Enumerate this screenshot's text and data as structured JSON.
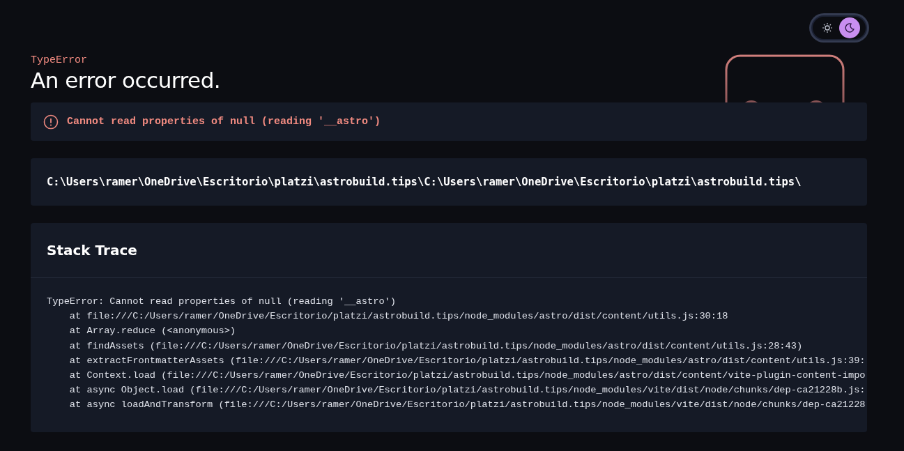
{
  "theme_toggle": {
    "options": [
      {
        "kind": "sun",
        "selected": false
      },
      {
        "kind": "moon",
        "selected": true
      }
    ]
  },
  "error": {
    "name": "TypeError",
    "title": "An error occurred.",
    "message": "Cannot read properties of null (reading '__astro')"
  },
  "file_path": "C:\\Users\\ramer\\OneDrive\\Escritorio\\platzi\\astrobuild.tips\\C:\\Users\\ramer\\OneDrive\\Escritorio\\platzi\\astrobuild.tips\\",
  "stack_trace": {
    "title": "Stack Trace",
    "lines": [
      "TypeError: Cannot read properties of null (reading '__astro')",
      "    at file:///C:/Users/ramer/OneDrive/Escritorio/platzi/astrobuild.tips/node_modules/astro/dist/content/utils.js:30:18",
      "    at Array.reduce (<anonymous>)",
      "    at findAssets (file:///C:/Users/ramer/OneDrive/Escritorio/platzi/astrobuild.tips/node_modules/astro/dist/content/utils.js:28:43)",
      "    at extractFrontmatterAssets (file:///C:/Users/ramer/OneDrive/Escritorio/platzi/astrobuild.tips/node_modules/astro/dist/content/utils.js:39:",
      "    at Context.load (file:///C:/Users/ramer/OneDrive/Escritorio/platzi/astrobuild.tips/node_modules/astro/dist/content/vite-plugin-content-impo",
      "    at async Object.load (file:///C:/Users/ramer/OneDrive/Escritorio/platzi/astrobuild.tips/node_modules/vite/dist/node/chunks/dep-ca21228b.js:",
      "    at async loadAndTransform (file:///C:/Users/ramer/OneDrive/Escritorio/platzi/astrobuild.tips/node_modules/vite/dist/node/chunks/dep-ca21228"
    ]
  }
}
